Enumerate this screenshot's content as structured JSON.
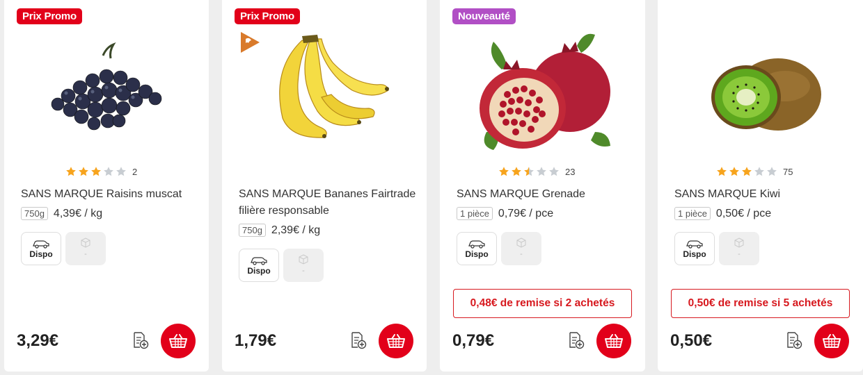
{
  "colors": {
    "promo": "#e2001a",
    "new": "#b14fc5",
    "star_on": "#f7a41d",
    "star_off": "#c8cdd2"
  },
  "products": [
    {
      "badge": "Prix Promo",
      "badge_type": "promo",
      "image_icon": "grapes-image",
      "rating": 3,
      "reviews": "2",
      "title": "SANS MARQUE Raisins muscat",
      "weight": "750g",
      "unit_price": "4,39€ / kg",
      "availability": {
        "drive_label": "Dispo",
        "delivery_label": "-"
      },
      "price": "3,29€"
    },
    {
      "badge": "Prix Promo",
      "badge_type": "promo",
      "brand_icon": "brand-logo-icon",
      "image_icon": "bananas-image",
      "title": "SANS MARQUE Bananes Fairtrade filière responsable",
      "weight": "750g",
      "unit_price": "2,39€ / kg",
      "availability": {
        "drive_label": "Dispo",
        "delivery_label": "-"
      },
      "price": "1,79€"
    },
    {
      "badge": "Nouveauté",
      "badge_type": "new",
      "image_icon": "pomegranate-image",
      "rating": 2.5,
      "reviews": "23",
      "title": "SANS MARQUE Grenade",
      "weight": "1 pièce",
      "unit_price": "0,79€ / pce",
      "availability": {
        "drive_label": "Dispo",
        "delivery_label": "-"
      },
      "remise": "0,48€ de remise si 2 achetés",
      "price": "0,79€"
    },
    {
      "image_icon": "kiwi-image",
      "rating": 3,
      "reviews": "75",
      "title": "SANS MARQUE Kiwi",
      "weight": "1 pièce",
      "unit_price": "0,50€ / pce",
      "availability": {
        "drive_label": "Dispo",
        "delivery_label": "-"
      },
      "remise": "0,50€ de remise si 5 achetés",
      "price": "0,50€"
    }
  ]
}
